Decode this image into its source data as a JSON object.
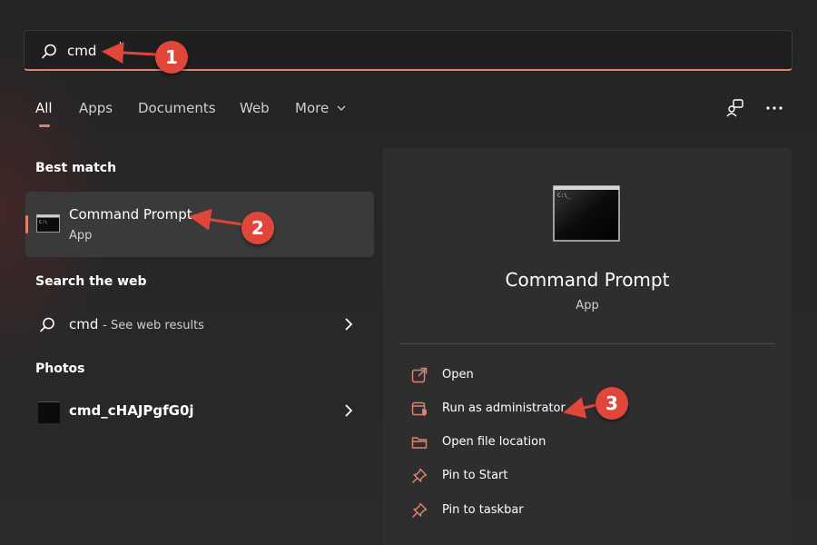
{
  "search": {
    "value": "cmd"
  },
  "tabs": [
    {
      "label": "All"
    },
    {
      "label": "Apps"
    },
    {
      "label": "Documents"
    },
    {
      "label": "Web"
    },
    {
      "label": "More"
    }
  ],
  "left": {
    "best_match_header": "Best match",
    "best_match": {
      "title": "Command Prompt",
      "subtitle": "App"
    },
    "web_header": "Search the web",
    "web_result": {
      "query": "cmd",
      "hint": "- See web results"
    },
    "photos_header": "Photos",
    "photo_result": {
      "name": "cmd_cHAJPgfG0j"
    }
  },
  "detail": {
    "title": "Command Prompt",
    "subtitle": "App",
    "actions": [
      {
        "label": "Open",
        "icon": "open-external-icon"
      },
      {
        "label": "Run as administrator",
        "icon": "shield-admin-icon"
      },
      {
        "label": "Open file location",
        "icon": "folder-icon"
      },
      {
        "label": "Pin to Start",
        "icon": "pin-icon"
      },
      {
        "label": "Pin to taskbar",
        "icon": "pin-icon"
      }
    ]
  },
  "callouts": [
    "1",
    "2",
    "3"
  ],
  "colors": {
    "accent": "#e0806e",
    "callout": "#e0463a",
    "background": "#262626",
    "panel": "#2e2e2e"
  }
}
